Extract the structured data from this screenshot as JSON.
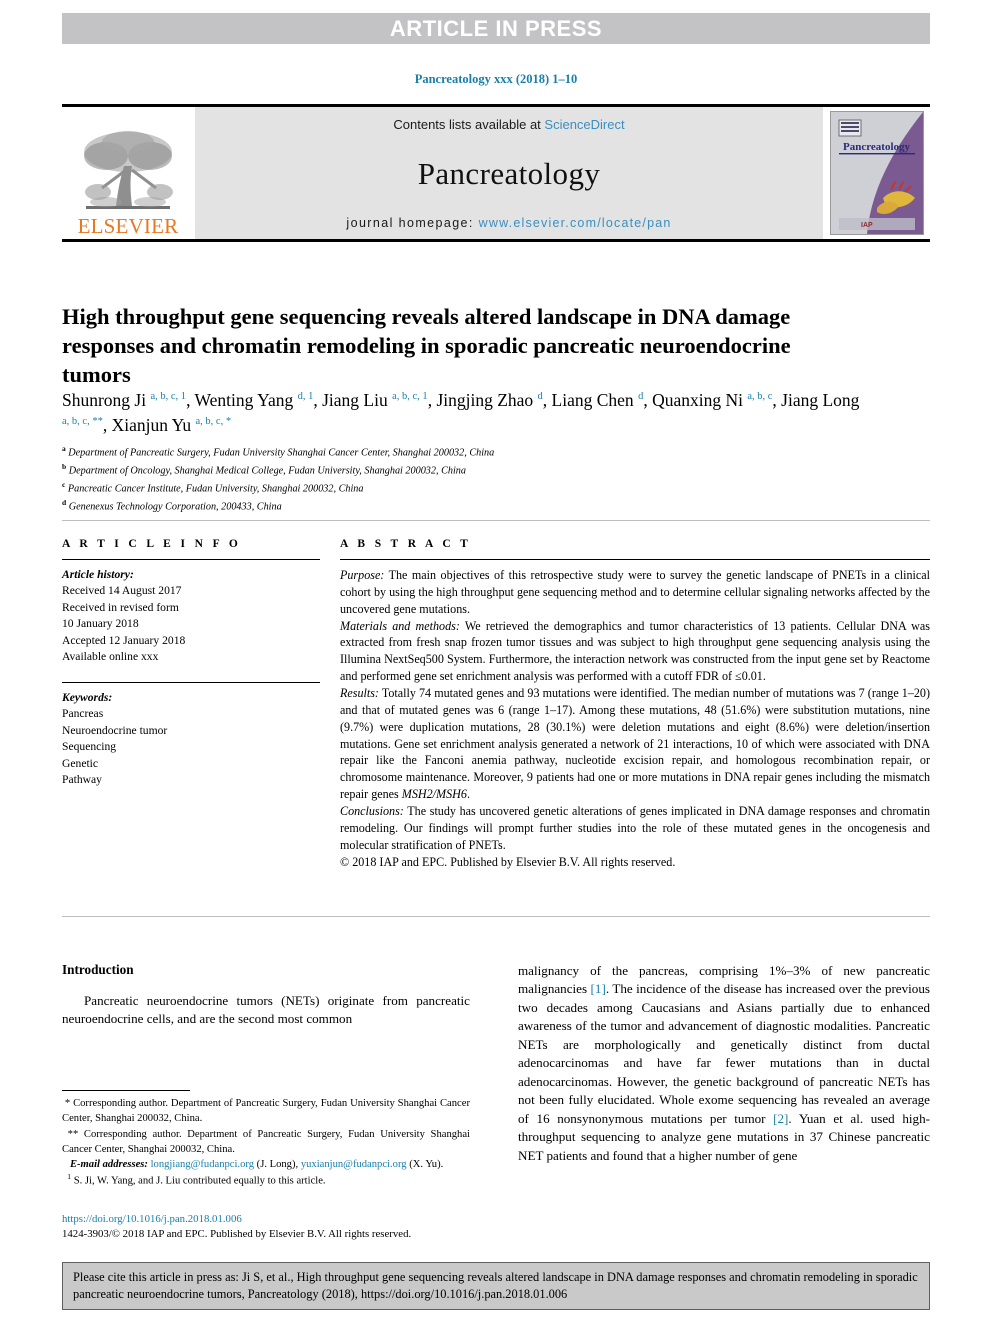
{
  "banner": {
    "text": "ARTICLE IN PRESS"
  },
  "running_head": {
    "text": "Pancreatology xxx (2018) 1–10"
  },
  "masthead": {
    "publisher_name": "ELSEVIER",
    "publisher_logo_icon": "elsevier-tree-icon",
    "contents_prefix": "Contents lists available at ",
    "contents_link": "ScienceDirect",
    "journal_title": "Pancreatology",
    "homepage_prefix": "journal homepage: ",
    "homepage_url": "www.elsevier.com/locate/pan",
    "cover_title": "Pancreatology",
    "cover_icon": "journal-cover-thumbnail"
  },
  "article": {
    "title": "High throughput gene sequencing reveals altered landscape in DNA damage responses and chromatin remodeling in sporadic pancreatic neuroendocrine tumors",
    "authors_html": "Shunrong Ji <sup>a, b, c, 1</sup>, Wenting Yang <sup>d, 1</sup>, Jiang Liu <sup>a, b, c, 1</sup>, Jingjing Zhao <sup>d</sup>, Liang Chen <sup>d</sup>, Quanxing Ni <sup>a, b, c</sup>, Jiang Long <sup>a, b, c, **</sup>, Xianjun Yu <sup>a, b, c, *</sup>",
    "affiliations": [
      {
        "mark": "a",
        "text": "Department of Pancreatic Surgery, Fudan University Shanghai Cancer Center, Shanghai 200032, China"
      },
      {
        "mark": "b",
        "text": "Department of Oncology, Shanghai Medical College, Fudan University, Shanghai 200032, China"
      },
      {
        "mark": "c",
        "text": "Pancreatic Cancer Institute, Fudan University, Shanghai 200032, China"
      },
      {
        "mark": "d",
        "text": "Genenexus Technology Corporation, 200433, China"
      }
    ]
  },
  "article_info": {
    "heading": "A R T I C L E   I N F O",
    "history_label": "Article history:",
    "history": [
      "Received 14 August 2017",
      "Received in revised form",
      "10 January 2018",
      "Accepted 12 January 2018",
      "Available online xxx"
    ],
    "keywords_label": "Keywords:",
    "keywords": [
      "Pancreas",
      "Neuroendocrine tumor",
      "Sequencing",
      "Genetic",
      "Pathway"
    ]
  },
  "abstract": {
    "heading": "A B S T R A C T",
    "purpose_label": "Purpose:",
    "purpose_text": " The main objectives of this retrospective study were to survey the genetic landscape of PNETs in a clinical cohort by using the high throughput gene sequencing method and to determine cellular signaling networks affected by the uncovered gene mutations.",
    "methods_label": "Materials and methods:",
    "methods_text": " We retrieved the demographics and tumor characteristics of 13 patients. Cellular DNA was extracted from fresh snap frozen tumor tissues and was subject to high throughput gene sequencing analysis using the Illumina NextSeq500 System. Furthermore, the interaction network was constructed from the input gene set by Reactome and performed gene set enrichment analysis was performed with a cutoff FDR of ≤0.01.",
    "results_label": "Results:",
    "results_text_1": " Totally 74 mutated genes and 93 mutations were identified. The median number of mutations was 7 (range 1–20) and that of mutated genes was 6 (range 1–17). Among these mutations, 48 (51.6%) were substitution mutations, nine (9.7%) were duplication mutations, 28 (30.1%) were deletion mutations and eight (8.6%) were deletion/insertion mutations. Gene set enrichment analysis generated a network of 21 interactions, 10 of which were associated with DNA repair like the Fanconi anemia pathway, nucleotide excision repair, and homologous recombination repair, or chromosome maintenance. Moreover, 9 patients had one or more mutations in DNA repair genes including the mismatch repair genes ",
    "results_genes": "MSH2/MSH6",
    "results_text_2": ".",
    "conclusions_label": "Conclusions:",
    "conclusions_text": " The study has uncovered genetic alterations of genes implicated in DNA damage responses and chromatin remodeling. Our findings will prompt further studies into the role of these mutated genes in the oncogenesis and molecular stratification of PNETs.",
    "copyright": "© 2018 IAP and EPC. Published by Elsevier B.V. All rights reserved."
  },
  "introduction": {
    "heading": "Introduction",
    "left_para_1": "Pancreatic neuroendocrine tumors (NETs) originate from pancreatic neuroendocrine cells, and are the second most common",
    "right_para_1a": "malignancy of the pancreas, comprising 1%–3% of new pancreatic malignancies ",
    "right_ref_1": "[1]",
    "right_para_1b": ". The incidence of the disease has increased over the previous two decades among Caucasians and Asians partially due to enhanced awareness of the tumor and advancement of diagnostic modalities. Pancreatic NETs are morphologically and genetically distinct from ductal adenocarcinomas and have far fewer mutations than in ductal adenocarcinomas. However, the genetic background of pancreatic NETs has not been fully elucidated. Whole exome sequencing has revealed an average of 16 nonsynonymous mutations per tumor ",
    "right_ref_2": "[2]",
    "right_para_1c": ". Yuan et al. used high-throughput sequencing to analyze gene mutations in 37 Chinese pancreatic NET patients and found that a higher number of gene"
  },
  "footnotes": {
    "corr_1_mark": "*",
    "corr_1_text": " Corresponding author. Department of Pancreatic Surgery, Fudan University Shanghai Cancer Center, Shanghai 200032, China.",
    "corr_2_mark": "**",
    "corr_2_text": " Corresponding author. Department of Pancreatic Surgery, Fudan University Shanghai Cancer Center, Shanghai 200032, China.",
    "email_label": "E-mail addresses:",
    "email_1": "longjiang@fudanpci.org",
    "email_1_owner": " (J. Long), ",
    "email_2": "yuxianjun@fudanpci.org",
    "email_2_owner": " (X. Yu).",
    "equal_mark": "1",
    "equal_text": " S. Ji, W. Yang, and J. Liu contributed equally to this article."
  },
  "doi_block": {
    "doi_url": "https://doi.org/10.1016/j.pan.2018.01.006",
    "issn_line": "1424-3903/© 2018 IAP and EPC. Published by Elsevier B.V. All rights reserved."
  },
  "citation_footer": {
    "text": "Please cite this article in press as: Ji S, et al., High throughput gene sequencing reveals altered landscape in DNA damage responses and chromatin remodeling in sporadic pancreatic neuroendocrine tumors, Pancreatology (2018), https://doi.org/10.1016/j.pan.2018.01.006"
  },
  "colors": {
    "link": "#1a7fa8",
    "banner_bg": "#c3c3c5",
    "masthead_bg": "#e3e3e3",
    "elsevier_orange": "#e87722",
    "citation_bg": "#c9c9c9"
  }
}
